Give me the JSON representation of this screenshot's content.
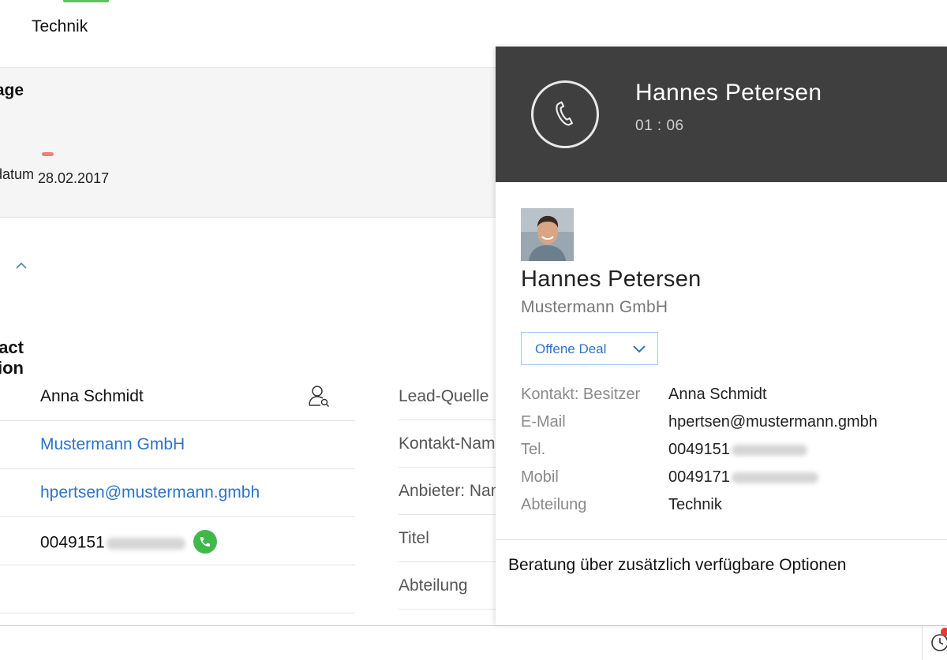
{
  "page": {
    "tab_title": "Technik",
    "summary": {
      "stage_label": "Stage",
      "date_label": "Abgabedatum",
      "date_value": "28.02.2017"
    },
    "section_title": "Contact Information",
    "left_fields": {
      "owner": "Anna Schmidt",
      "company": "Mustermann GmbH",
      "email": "hpertsen@mustermann.gmbh",
      "phone": "0049151"
    },
    "right_labels": [
      "Lead-Quelle",
      "Kontakt-Name",
      "Anbieter: Name",
      "Titel",
      "Abteilung"
    ]
  },
  "call": {
    "caller_name": "Hannes Petersen",
    "timer": "01 : 06",
    "contact": {
      "name": "Hannes Petersen",
      "company": "Mustermann GmbH"
    },
    "deal_dropdown": "Offene Deal",
    "details": [
      {
        "label": "Kontakt: Besitzer",
        "value": "Anna Schmidt"
      },
      {
        "label": "E-Mail",
        "value": "hpertsen@mustermann.gmbh"
      },
      {
        "label": "Tel.",
        "value": "0049151"
      },
      {
        "label": "Mobil",
        "value": "0049171"
      },
      {
        "label": "Abteilung",
        "value": "Technik"
      }
    ],
    "note": "Beratung über zusätzlich verfügbare Optionen"
  },
  "colors": {
    "header_bg": "#3f3f3f",
    "link": "#2e73c7",
    "call_green": "#41b94a",
    "accent_green": "#5cc36a",
    "stage_red": "#ee8080",
    "notification_red": "#e53935"
  },
  "icons": [
    "phone-icon",
    "owner-lookup-icon",
    "call-icon",
    "chevron-up-icon",
    "chevron-down-icon",
    "clock-icon"
  ]
}
